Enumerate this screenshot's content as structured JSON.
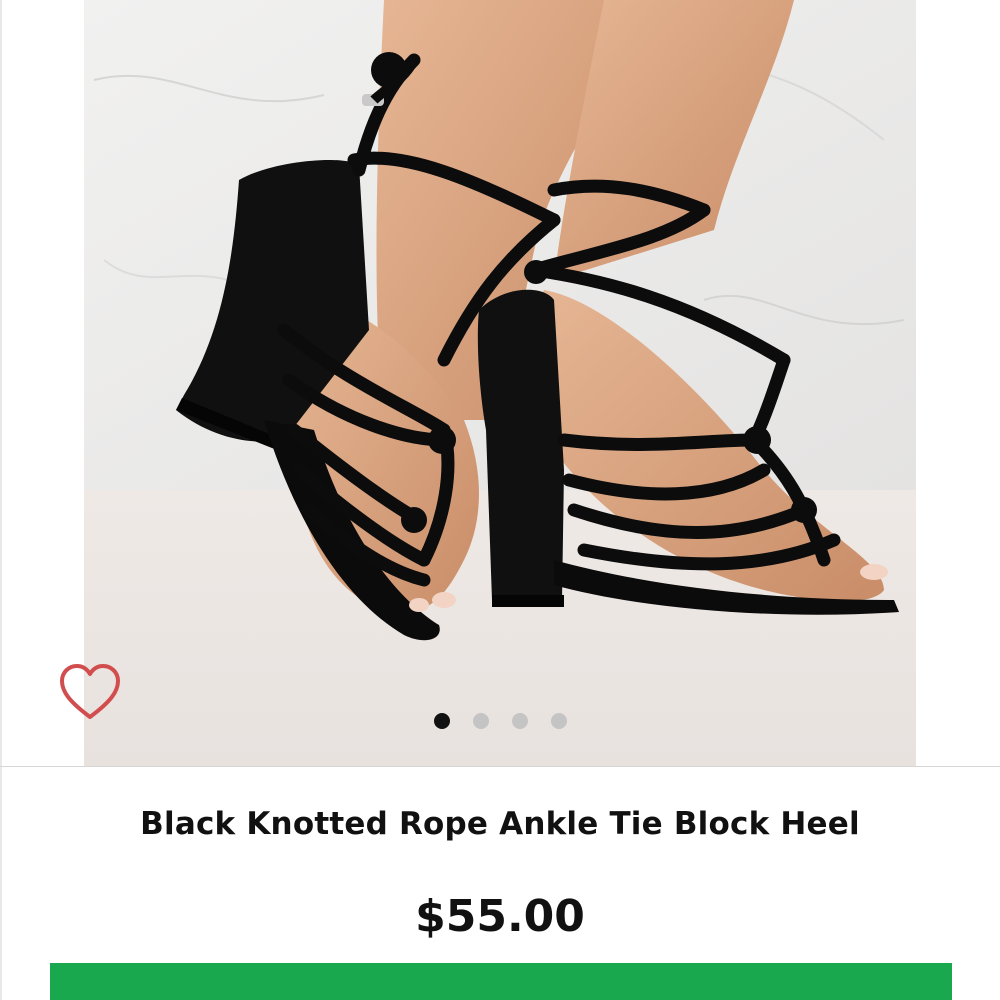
{
  "product": {
    "title": "Black Knotted Rope Ankle Tie Block Heel",
    "price": "$55.00",
    "image_alt": "Black knotted rope ankle tie block heel sandals",
    "is_wishlisted": false
  },
  "gallery": {
    "current_slide": 1,
    "slide_count": 4
  },
  "icons": {
    "wishlist": "heart-outline-icon"
  },
  "colors": {
    "wishlist_heart": "#d24d4d",
    "active_dot": "#111111",
    "inactive_dot": "#c4c4c4",
    "cta_button": "#1aa84e",
    "text": "#111111"
  }
}
